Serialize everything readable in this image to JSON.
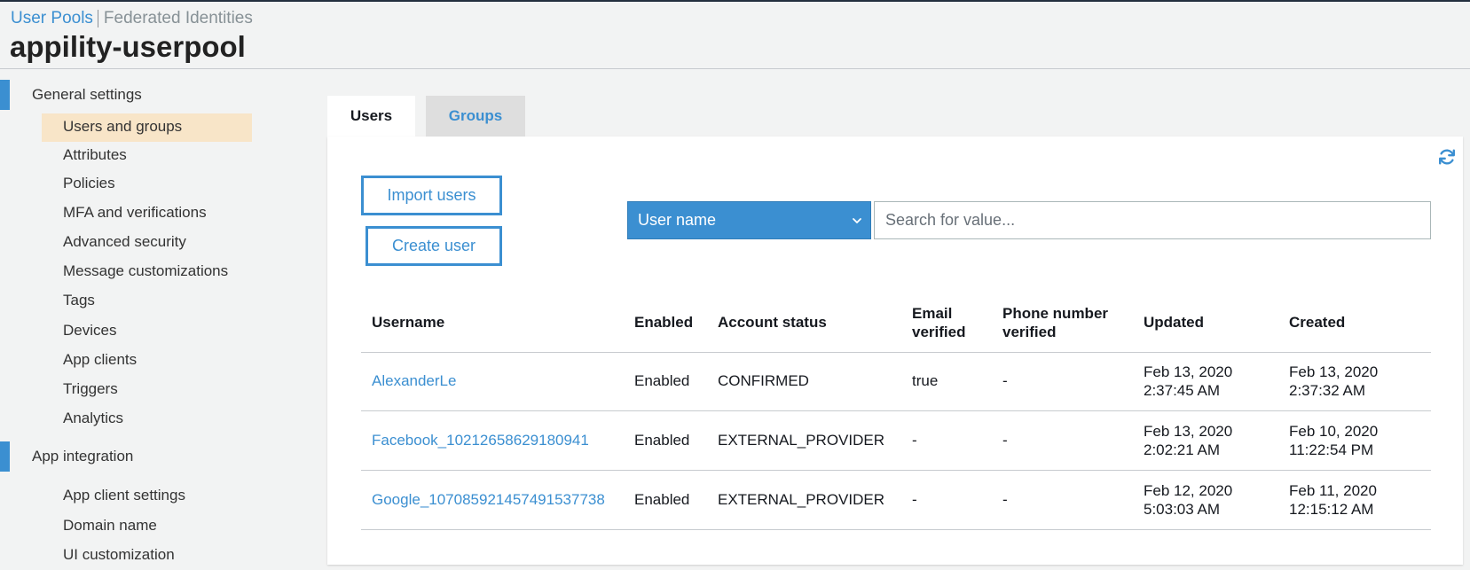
{
  "breadcrumb": {
    "user_pools": "User Pools",
    "federated_identities": "Federated Identities"
  },
  "pool_name": "appility-userpool",
  "sidebar": {
    "sections": [
      {
        "label": "General settings",
        "items": [
          {
            "label": "Users and groups",
            "active": true
          },
          {
            "label": "Attributes"
          },
          {
            "label": "Policies"
          },
          {
            "label": "MFA and verifications"
          },
          {
            "label": "Advanced security"
          },
          {
            "label": "Message customizations"
          },
          {
            "label": "Tags"
          },
          {
            "label": "Devices"
          },
          {
            "label": "App clients"
          },
          {
            "label": "Triggers"
          },
          {
            "label": "Analytics"
          }
        ]
      },
      {
        "label": "App integration",
        "items": [
          {
            "label": "App client settings"
          },
          {
            "label": "Domain name"
          },
          {
            "label": "UI customization"
          }
        ]
      }
    ]
  },
  "tabs": [
    {
      "label": "Users",
      "active": true
    },
    {
      "label": "Groups",
      "active": false
    }
  ],
  "actions": {
    "import_users": "Import users",
    "create_user": "Create user",
    "refresh_icon": "refresh-icon"
  },
  "filter": {
    "attribute": "User name",
    "search_placeholder": "Search for value..."
  },
  "table": {
    "columns": {
      "username": "Username",
      "enabled": "Enabled",
      "account_status": "Account status",
      "email_verified_1": "Email",
      "email_verified_2": "verified",
      "phone_verified_1": "Phone number",
      "phone_verified_2": "verified",
      "updated": "Updated",
      "created": "Created"
    },
    "rows": [
      {
        "username": "AlexanderLe",
        "enabled": "Enabled",
        "account_status": "CONFIRMED",
        "email_verified": "true",
        "phone_verified": "-",
        "updated_date": "Feb 13, 2020",
        "updated_time": "2:37:45 AM",
        "created_date": "Feb 13, 2020",
        "created_time": "2:37:32 AM"
      },
      {
        "username": "Facebook_10212658629180941",
        "enabled": "Enabled",
        "account_status": "EXTERNAL_PROVIDER",
        "email_verified": "-",
        "phone_verified": "-",
        "updated_date": "Feb 13, 2020",
        "updated_time": "2:02:21 AM",
        "created_date": "Feb 10, 2020",
        "created_time": "11:22:54 PM"
      },
      {
        "username": "Google_107085921457491537738",
        "enabled": "Enabled",
        "account_status": "EXTERNAL_PROVIDER",
        "email_verified": "-",
        "phone_verified": "-",
        "updated_date": "Feb 12, 2020",
        "updated_time": "5:03:03 AM",
        "created_date": "Feb 11, 2020",
        "created_time": "12:15:12 AM"
      }
    ]
  },
  "colors": {
    "accent": "#3b8fd1",
    "active_item_bg": "#f8e5c8",
    "page_bg": "#f2f3f3"
  }
}
